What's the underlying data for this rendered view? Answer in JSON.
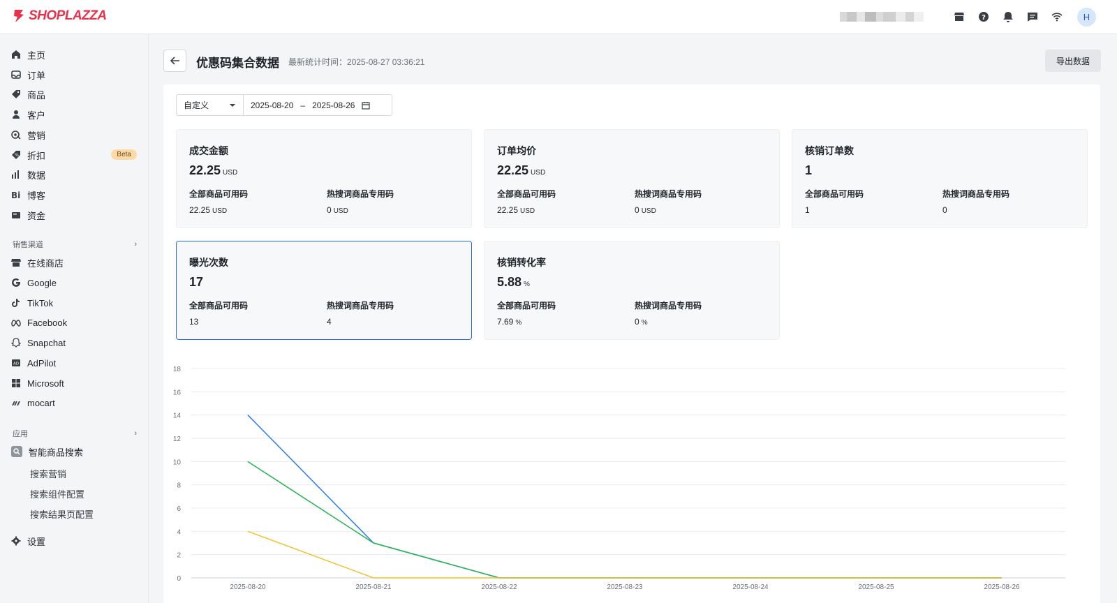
{
  "brand": {
    "name": "SHOPLAZZA",
    "color": "#e8324d"
  },
  "header": {
    "avatar_letter": "H",
    "icons": [
      "store-icon",
      "help-icon",
      "bell-icon",
      "message-icon",
      "wifi-icon"
    ]
  },
  "sidebar": {
    "main_items": [
      {
        "label": "主页",
        "icon": "home-icon"
      },
      {
        "label": "订单",
        "icon": "inbox-icon"
      },
      {
        "label": "商品",
        "icon": "tag-icon"
      },
      {
        "label": "客户",
        "icon": "user-icon"
      },
      {
        "label": "营销",
        "icon": "marketing-icon"
      },
      {
        "label": "折扣",
        "icon": "discount-icon",
        "badge": "Beta"
      },
      {
        "label": "数据",
        "icon": "bar-chart-icon"
      },
      {
        "label": "博客",
        "icon": "blog-icon"
      },
      {
        "label": "资金",
        "icon": "wallet-icon"
      }
    ],
    "sales_channels_title": "销售渠道",
    "channels": [
      {
        "label": "在线商店",
        "icon": "store-icon"
      },
      {
        "label": "Google",
        "icon": "google-icon"
      },
      {
        "label": "TikTok",
        "icon": "tiktok-icon"
      },
      {
        "label": "Facebook",
        "icon": "meta-icon"
      },
      {
        "label": "Snapchat",
        "icon": "snapchat-icon"
      },
      {
        "label": "AdPilot",
        "icon": "adpilot-icon"
      },
      {
        "label": "Microsoft",
        "icon": "microsoft-icon"
      },
      {
        "label": "mocart",
        "icon": "mocart-icon"
      }
    ],
    "apps_title": "应用",
    "app": {
      "label": "智能商品搜索",
      "icon": "smart-search-icon"
    },
    "app_subitems": [
      "搜索营销",
      "搜索组件配置",
      "搜索结果页配置"
    ],
    "settings": {
      "label": "设置",
      "icon": "gear-icon"
    }
  },
  "page": {
    "title": "优惠码集合数据",
    "stat_time": "最新统计时间：2025-08-27 03:36:21",
    "export_label": "导出数据"
  },
  "filter": {
    "mode": "自定义",
    "start_date": "2025-08-20",
    "separator": "–",
    "end_date": "2025-08-26"
  },
  "cards": [
    {
      "title": "成交金额",
      "value": "22.25",
      "unit": "USD",
      "left_label": "全部商品可用码",
      "left_value": "22.25",
      "left_unit": "USD",
      "right_label": "热搜词商品专用码",
      "right_value": "0",
      "right_unit": "USD"
    },
    {
      "title": "订单均价",
      "value": "22.25",
      "unit": "USD",
      "left_label": "全部商品可用码",
      "left_value": "22.25",
      "left_unit": "USD",
      "right_label": "热搜词商品专用码",
      "right_value": "0",
      "right_unit": "USD"
    },
    {
      "title": "核销订单数",
      "value": "1",
      "unit": "",
      "left_label": "全部商品可用码",
      "left_value": "1",
      "left_unit": "",
      "right_label": "热搜词商品专用码",
      "right_value": "0",
      "right_unit": ""
    },
    {
      "title": "曝光次数",
      "value": "17",
      "unit": "",
      "left_label": "全部商品可用码",
      "left_value": "13",
      "left_unit": "",
      "right_label": "热搜词商品专用码",
      "right_value": "4",
      "right_unit": ""
    },
    {
      "title": "核销转化率",
      "value": "5.88",
      "unit": "%",
      "left_label": "全部商品可用码",
      "left_value": "7.69",
      "left_unit": "%",
      "right_label": "热搜词商品专用码",
      "right_value": "0",
      "right_unit": "%"
    }
  ],
  "chart_data": {
    "type": "line",
    "x": [
      "2025-08-20",
      "2025-08-21",
      "2025-08-22",
      "2025-08-23",
      "2025-08-24",
      "2025-08-25",
      "2025-08-26"
    ],
    "ylim": [
      0,
      18
    ],
    "yticks": [
      0,
      2,
      4,
      6,
      8,
      10,
      12,
      14,
      16,
      18
    ],
    "grid": true,
    "series": [
      {
        "color": "#2b7de9",
        "values": [
          14,
          3,
          0,
          0,
          0,
          0,
          0
        ]
      },
      {
        "color": "#25b352",
        "values": [
          10,
          3,
          0,
          0,
          0,
          0,
          0
        ]
      },
      {
        "color": "#f5bf2a",
        "values": [
          4,
          0,
          0,
          0,
          0,
          0,
          0
        ]
      }
    ]
  }
}
